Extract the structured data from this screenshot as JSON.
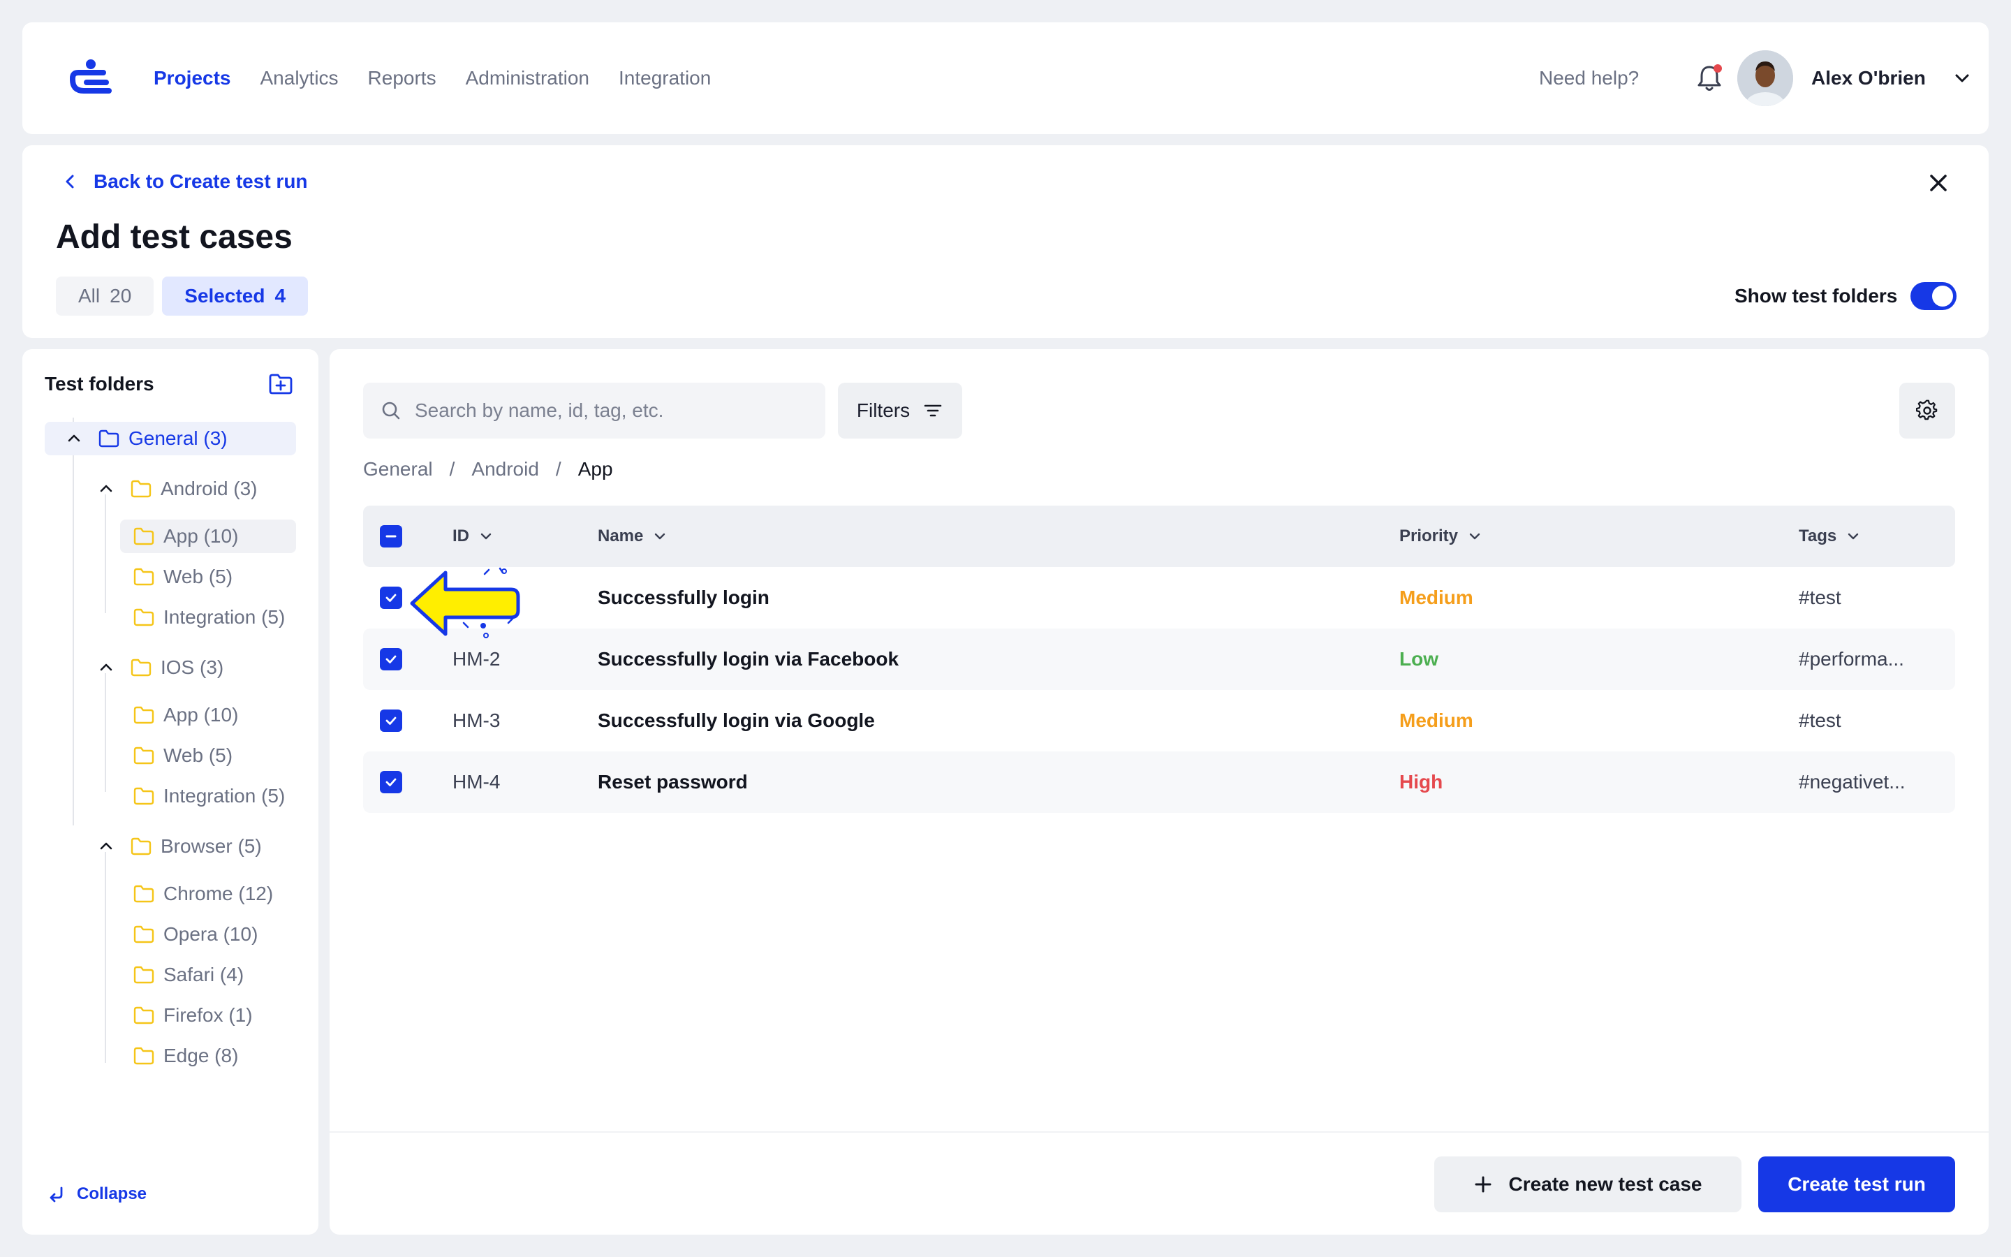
{
  "colors": {
    "accent": "#1638e6",
    "medium": "#f59e1b",
    "low": "#4caf50",
    "high": "#e5484d",
    "folder": "#f5c518",
    "arrow": "#ffee00"
  },
  "header": {
    "nav": [
      "Projects",
      "Analytics",
      "Reports",
      "Administration",
      "Integration"
    ],
    "active_nav": "Projects",
    "help": "Need help?",
    "user_name": "Alex O'brien"
  },
  "title_panel": {
    "back_label": "Back to Create test run",
    "title": "Add test cases",
    "tabs": [
      {
        "label": "All",
        "count": "20"
      },
      {
        "label": "Selected",
        "count": "4"
      }
    ],
    "show_folders_label": "Show test folders",
    "show_folders_on": true
  },
  "sidebar": {
    "title": "Test folders",
    "tree": [
      {
        "label": "General (3)"
      },
      {
        "label": "Android (3)"
      },
      {
        "label": "App (10)"
      },
      {
        "label": "Web (5)"
      },
      {
        "label": "Integration (5)"
      },
      {
        "label": "IOS (3)"
      },
      {
        "label": "App (10)"
      },
      {
        "label": "Web (5)"
      },
      {
        "label": "Integration (5)"
      },
      {
        "label": "Browser (5)"
      },
      {
        "label": "Chrome (12)"
      },
      {
        "label": "Opera (10)"
      },
      {
        "label": "Safari (4)"
      },
      {
        "label": "Firefox (1)"
      },
      {
        "label": "Edge (8)"
      }
    ],
    "collapse_label": "Collapse"
  },
  "main": {
    "search_placeholder": "Search by name, id, tag, etc.",
    "filters_label": "Filters",
    "breadcrumb": [
      "General",
      "Android",
      "App"
    ],
    "columns": {
      "id": "ID",
      "name": "Name",
      "priority": "Priority",
      "tags": "Tags"
    },
    "rows": [
      {
        "id": "",
        "name": "Successfully login",
        "priority": "Medium",
        "tags": "#test",
        "checked": true
      },
      {
        "id": "HM-2",
        "name": "Successfully login via Facebook",
        "priority": "Low",
        "tags": "#performa...",
        "checked": true
      },
      {
        "id": "HM-3",
        "name": "Successfully login via Google",
        "priority": "Medium",
        "tags": "#test",
        "checked": true
      },
      {
        "id": "HM-4",
        "name": "Reset password",
        "priority": "High",
        "tags": "#negativet...",
        "checked": true
      }
    ],
    "create_new_label": "Create new test case",
    "create_run_label": "Create test run"
  }
}
